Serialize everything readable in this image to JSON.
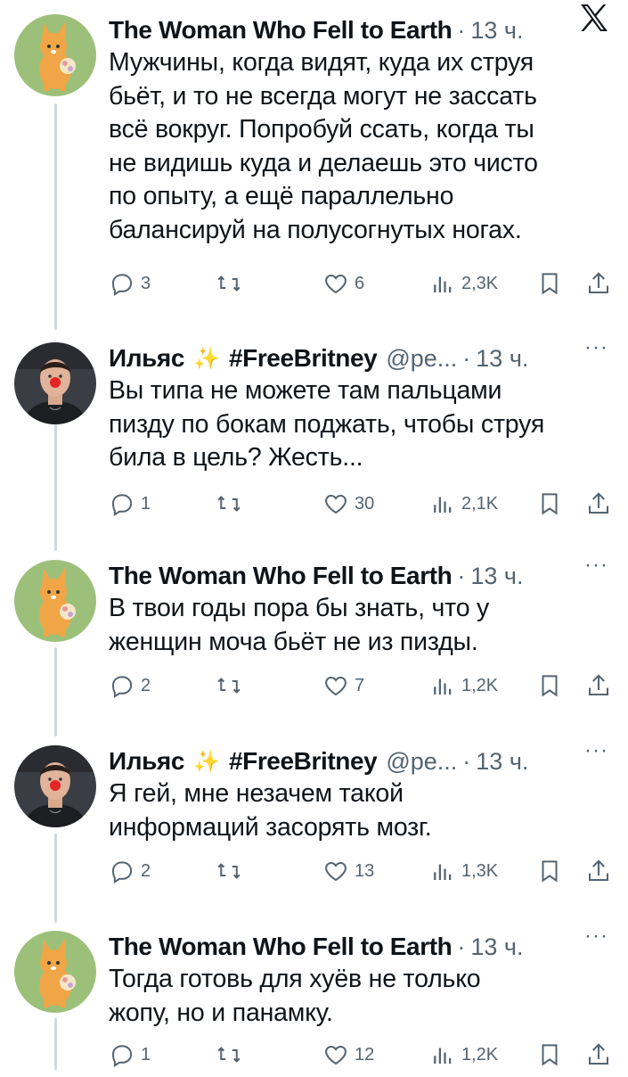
{
  "platform": {
    "logo": "x-logo"
  },
  "colors": {
    "text": "#0f1419",
    "secondary": "#536471",
    "line": "#cfd9de",
    "sparkle": "#f5c842"
  },
  "tweets": [
    {
      "author": "The Woman Who Fell to Earth",
      "handle": "",
      "time": "13 ч.",
      "text": "Мужчины, когда видят, куда их струя\nбьёт, и то не всегда могут не зассать\nвсё вокруг. Попробуй ссать, когда ты\nне видишь куда и делаешь это чисто\nпо опыту, а ещё параллельно\nбалансируй на полусогнутых ногах.",
      "replies": "3",
      "reposts": "",
      "likes": "6",
      "views": "2,3K"
    },
    {
      "author": "Ильяс",
      "emoji": "✨",
      "tag": "#FreeBritney",
      "handle": "@pe...",
      "time": "13 ч.",
      "text": "Вы типа не можете там пальцами\nпизду по бокам поджать, чтобы струя\nбила в цель? Жесть...",
      "replies": "1",
      "reposts": "",
      "likes": "30",
      "views": "2,1K"
    },
    {
      "author": "The Woman Who Fell to Earth",
      "handle": "",
      "time": "13 ч.",
      "text": "В твои годы пора бы знать, что у\nженщин моча бьёт не из пизды.",
      "replies": "2",
      "reposts": "",
      "likes": "7",
      "views": "1,2K"
    },
    {
      "author": "Ильяс",
      "emoji": "✨",
      "tag": "#FreeBritney",
      "handle": "@pe...",
      "time": "13 ч.",
      "text": "Я гей, мне незачем такой\nинформаций засорять мозг.",
      "replies": "2",
      "reposts": "",
      "likes": "13",
      "views": "1,3K"
    },
    {
      "author": "The Woman Who Fell to Earth",
      "handle": "",
      "time": "13 ч.",
      "text": "Тогда готовь для хуёв не только\nжопу, но и панамку.",
      "replies": "1",
      "reposts": "",
      "likes": "12",
      "views": "1,2K"
    }
  ]
}
